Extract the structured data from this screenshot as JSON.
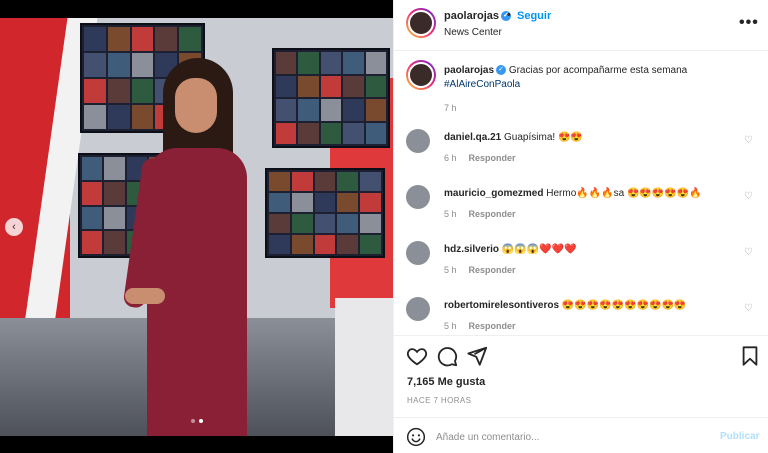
{
  "post": {
    "username": "paolarojas",
    "follow_label": "Seguir",
    "separator": "•",
    "location": "News Center",
    "more_icon": "more-horizontal-icon",
    "verified_icon": "verified-badge-icon",
    "caption": {
      "username": "paolarojas",
      "text": "Gracias por acompañarme esta semana",
      "hashtag": "#AlAireConPaola",
      "time": "7 h"
    },
    "comments": [
      {
        "username": "daniel.qa.21",
        "text": "Guapísima! 😍😍",
        "time": "6 h",
        "reply_label": "Responder"
      },
      {
        "username": "mauricio_gomezmed",
        "text": "Hermo🔥🔥🔥sa 😍😍😍😍😍🔥",
        "time": "5 h",
        "reply_label": "Responder"
      },
      {
        "username": "hdz.silverio",
        "text": "😱😱😱❤️❤️❤️",
        "time": "5 h",
        "reply_label": "Responder"
      },
      {
        "username": "robertomirelesontiveros",
        "text": "😍😍😍😍😍😍😍😍😍😍",
        "time": "5 h",
        "reply_label": "Responder"
      }
    ],
    "likes_text": "7,165 Me gusta",
    "posted_ago": "HACE 7 HORAS",
    "comment_placeholder": "Añade un comentario...",
    "publish_label": "Publicar",
    "carousel": {
      "total": 2,
      "current": 2
    }
  },
  "colors": {
    "accent": "#0095f6",
    "publish_disabled": "#b2dffc",
    "verified": "#3897f0",
    "dress": "#8a2035",
    "studio_red": "#d1262c"
  }
}
